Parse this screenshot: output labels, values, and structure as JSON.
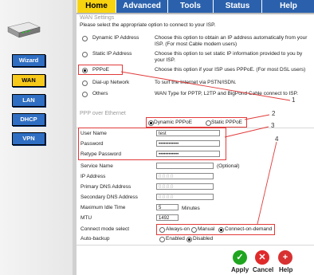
{
  "tabs": [
    "Home",
    "Advanced",
    "Tools",
    "Status",
    "Help"
  ],
  "sidebar": {
    "items": [
      "Wizard",
      "WAN",
      "LAN",
      "DHCP",
      "VPN"
    ]
  },
  "wan": {
    "title": "WAN Settings",
    "instruction": "Please select the appropriate option to connect to your ISP.",
    "options": [
      {
        "label": "Dynamic IP Address",
        "desc": "Choose this option to obtain an IP address automatically from your ISP. (For most Cable modem users)",
        "selected": false
      },
      {
        "label": "Static IP Address",
        "desc": "Choose this option to set static IP information provided to you by your ISP.",
        "selected": false
      },
      {
        "label": "PPPoE",
        "desc": "Choose this option if your ISP uses PPPoE. (For most DSL users)",
        "selected": true
      },
      {
        "label": "Dial-up Network",
        "desc": "To surf the Internet via PSTN/ISDN.",
        "selected": false
      },
      {
        "label": "Others",
        "desc": "WAN Type for PPTP, L2TP and BigPond Cable connect to ISP.",
        "selected": false
      }
    ]
  },
  "pppoe": {
    "title": "PPP over Ethernet",
    "mode_dynamic": "Dynamic PPPoE",
    "mode_static": "Static PPPoE",
    "fields": {
      "user_name": {
        "label": "User Name",
        "value": "test"
      },
      "password": {
        "label": "Password",
        "value": "••••••••••••"
      },
      "retype": {
        "label": "Retype Password",
        "value": "••••••••••••"
      },
      "service_name": {
        "label": "Service Name",
        "value": "",
        "suffix": "(Optional)"
      },
      "ip": {
        "label": "IP Address",
        "value": "0.0.0.0"
      },
      "dns1": {
        "label": "Primary DNS Address",
        "value": "0.0.0.0"
      },
      "dns2": {
        "label": "Secondary DNS Address",
        "value": "0.0.0.0"
      },
      "idle": {
        "label": "Maximum Idle Time",
        "value": "5",
        "suffix": "Minutes"
      },
      "mtu": {
        "label": "MTU",
        "value": "1492"
      }
    },
    "connect_mode": {
      "label": "Connect mode select",
      "options": [
        "Always-on",
        "Manual",
        "Connect-on-demand"
      ],
      "selected": "Connect-on-demand"
    },
    "auto_backup": {
      "label": "Auto-backup",
      "options": [
        "Enabled",
        "Disabled"
      ],
      "selected": "Disabled"
    }
  },
  "callouts": [
    "1",
    "2",
    "3",
    "4"
  ],
  "actions": {
    "apply": "Apply",
    "cancel": "Cancel",
    "help": "Help"
  },
  "colors": {
    "tab_blue": "#2b61ac",
    "active_yellow": "#f7d40f",
    "annotation_red": "#e23a3a"
  }
}
